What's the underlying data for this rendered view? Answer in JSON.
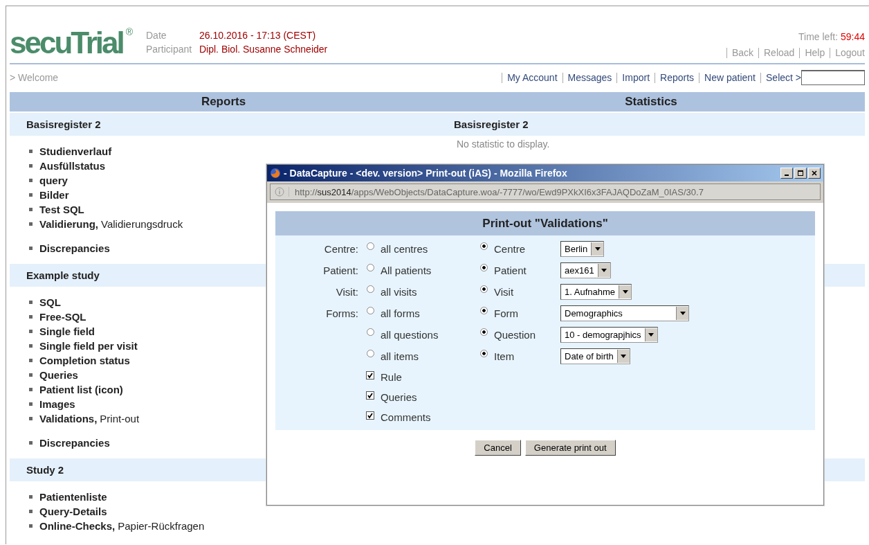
{
  "logo": {
    "name": "secuTrial",
    "mark": "®"
  },
  "info": [
    {
      "label": "Date",
      "value": "26.10.2016 - 17:13 (CEST)"
    },
    {
      "label": "Participant",
      "value": "Dipl. Biol. Susanne Schneider"
    }
  ],
  "timer": {
    "label": "Time left:",
    "value": "59:44"
  },
  "top_links": [
    "Back",
    "Reload",
    "Help",
    "Logout"
  ],
  "breadcrumb": "> Welcome",
  "nav_links": [
    "My Account",
    "Messages",
    "Import",
    "Reports",
    "New patient"
  ],
  "select": {
    "label": "Select >"
  },
  "columns": [
    "Reports",
    "Statistics"
  ],
  "sections": [
    {
      "title": "Basisregister 2",
      "stats_title": "Basisregister 2",
      "stats_text": "No statistic to display.",
      "groups": [
        [
          {
            "name": "Studienverlauf"
          },
          {
            "name": "Ausfüllstatus"
          },
          {
            "name": "query"
          },
          {
            "name": "Bilder"
          },
          {
            "name": "Test SQL"
          },
          {
            "name": "Validierung,",
            "note": "Validierungsdruck"
          }
        ],
        [
          {
            "name": "Discrepancies"
          }
        ]
      ]
    },
    {
      "title": "Example study",
      "groups": [
        [
          {
            "name": "SQL"
          },
          {
            "name": "Free-SQL"
          },
          {
            "name": "Single field"
          },
          {
            "name": "Single field per visit"
          },
          {
            "name": "Completion status"
          },
          {
            "name": "Queries"
          },
          {
            "name": "Patient list (icon)"
          },
          {
            "name": "Images"
          },
          {
            "name": "Validations,",
            "note": "Print-out"
          }
        ],
        [
          {
            "name": "Discrepancies"
          }
        ]
      ]
    },
    {
      "title": "Study 2",
      "groups": [
        [
          {
            "name": "Patientenliste"
          },
          {
            "name": "Query-Details"
          },
          {
            "name": "Online-Checks,",
            "note": "Papier-Rückfragen"
          }
        ]
      ]
    }
  ],
  "popup": {
    "title": "- DataCapture - <dev. version> Print-out (iAS) - Mozilla Firefox",
    "url": {
      "scheme": "http://",
      "host": "sus2014",
      "path": "/apps/WebObjects/DataCapture.woa/-7777/wo/Ewd9PXkXI6x3FAJAQDoZaM_0IAS/30.7"
    },
    "heading": "Print-out \"Validations\"",
    "rows": [
      {
        "label": "Centre:",
        "all": {
          "label": "all centres",
          "selected": false
        },
        "one": {
          "label": "Centre",
          "selected": true
        },
        "value": "Berlin"
      },
      {
        "label": "Patient:",
        "all": {
          "label": "All patients",
          "selected": false
        },
        "one": {
          "label": "Patient",
          "selected": true
        },
        "value": "aex161"
      },
      {
        "label": "Visit:",
        "all": {
          "label": "all visits",
          "selected": false
        },
        "one": {
          "label": "Visit",
          "selected": true
        },
        "value": "1. Aufnahme"
      },
      {
        "label": "Forms:",
        "all": {
          "label": "all forms",
          "selected": false
        },
        "one": {
          "label": "Form",
          "selected": true
        },
        "value": "Demographics"
      },
      {
        "all": {
          "label": "all questions",
          "selected": false
        },
        "one": {
          "label": "Question",
          "selected": true
        },
        "value": "10 - demograpjhics"
      },
      {
        "all": {
          "label": "all items",
          "selected": false
        },
        "one": {
          "label": "Item",
          "selected": true
        },
        "value": "Date of birth"
      }
    ],
    "checkboxes": [
      {
        "label": "Rule",
        "checked": true
      },
      {
        "label": "Queries",
        "checked": true
      },
      {
        "label": "Comments",
        "checked": true
      }
    ],
    "buttons": [
      "Cancel",
      "Generate print out"
    ]
  }
}
